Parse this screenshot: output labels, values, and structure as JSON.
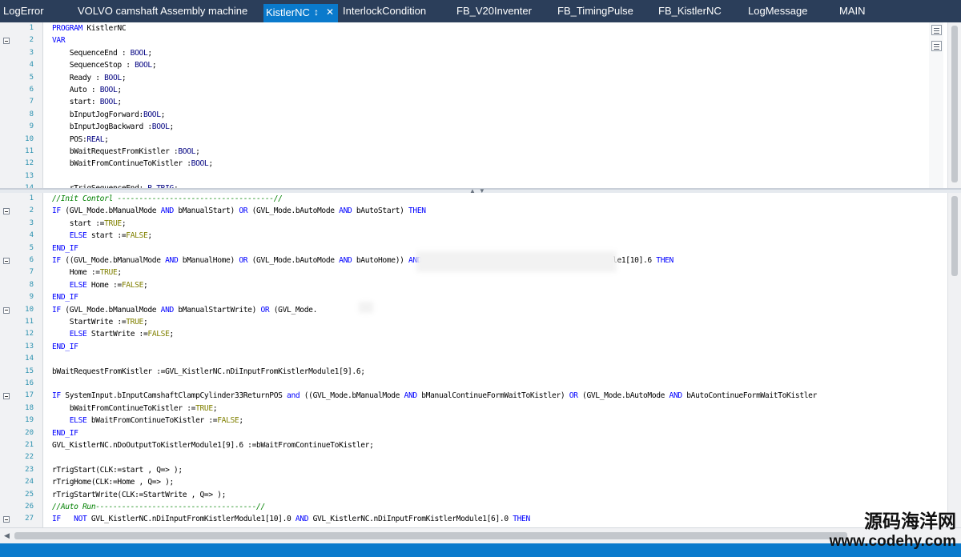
{
  "tabs": [
    {
      "label": "LogError"
    },
    {
      "label": "VOLVO camshaft Assembly machine"
    },
    {
      "label": "KistlerNC",
      "active": true
    },
    {
      "label": "InterlockCondition"
    },
    {
      "label": "FB_V20Inventer"
    },
    {
      "label": "FB_TimingPulse"
    },
    {
      "label": "FB_KistlerNC"
    },
    {
      "label": "LogMessage"
    },
    {
      "label": "MAIN"
    }
  ],
  "active_tab_pin_icon": "pin-icon",
  "active_tab_close_icon": "close-icon",
  "declaration_lines": [
    {
      "n": "1",
      "fold": false
    },
    {
      "n": "2",
      "fold": true
    },
    {
      "n": "3",
      "fold": false
    },
    {
      "n": "4",
      "fold": false
    },
    {
      "n": "5",
      "fold": false
    },
    {
      "n": "6",
      "fold": false
    },
    {
      "n": "7",
      "fold": false
    },
    {
      "n": "8",
      "fold": false
    },
    {
      "n": "9",
      "fold": false
    },
    {
      "n": "10",
      "fold": false
    },
    {
      "n": "11",
      "fold": false
    },
    {
      "n": "12",
      "fold": false
    },
    {
      "n": "13",
      "fold": false
    },
    {
      "n": "14",
      "fold": false
    }
  ],
  "declaration_code": [
    "PROGRAM KistlerNC",
    "VAR",
    "    SequenceEnd : BOOL;",
    "    SequenceStop : BOOL;",
    "    Ready : BOOL;",
    "    Auto : BOOL;",
    "    start: BOOL;",
    "    bInputJogForward:BOOL;",
    "    bInputJogBackward :BOOL;",
    "    POS:REAL;",
    "    bWaitRequestFromKistler :BOOL;",
    "    bWaitFromContinueToKistler :BOOL;",
    "",
    "    rTrigSequenceEnd: R_TRIG;"
  ],
  "implementation_lines": [
    {
      "n": "1",
      "fold": false
    },
    {
      "n": "2",
      "fold": true
    },
    {
      "n": "3",
      "fold": false
    },
    {
      "n": "4",
      "fold": false
    },
    {
      "n": "5",
      "fold": false
    },
    {
      "n": "6",
      "fold": true
    },
    {
      "n": "7",
      "fold": false
    },
    {
      "n": "8",
      "fold": false
    },
    {
      "n": "9",
      "fold": false
    },
    {
      "n": "10",
      "fold": true
    },
    {
      "n": "11",
      "fold": false
    },
    {
      "n": "12",
      "fold": false
    },
    {
      "n": "13",
      "fold": false
    },
    {
      "n": "14",
      "fold": false
    },
    {
      "n": "15",
      "fold": false
    },
    {
      "n": "16",
      "fold": false
    },
    {
      "n": "17",
      "fold": true
    },
    {
      "n": "18",
      "fold": false
    },
    {
      "n": "19",
      "fold": false
    },
    {
      "n": "20",
      "fold": false
    },
    {
      "n": "21",
      "fold": false
    },
    {
      "n": "22",
      "fold": false
    },
    {
      "n": "23",
      "fold": false
    },
    {
      "n": "24",
      "fold": false
    },
    {
      "n": "25",
      "fold": false
    },
    {
      "n": "26",
      "fold": false
    },
    {
      "n": "27",
      "fold": true
    }
  ],
  "implementation_code": [
    "//Init Contorl ------------------------------------//",
    "IF (GVL_Mode.bManualMode AND bManualStart) OR (GVL_Mode.bAutoMode AND bAutoStart) THEN",
    "    start :=TRUE;",
    "    ELSE start :=FALSE;",
    "END_IF",
    "IF ((GVL_Mode.bManualMode AND bManualHome) OR (GVL_Mode.bAutoMode AND bAutoHome)) AND NOT G                      tFromKistlerModule1[10].6 THEN",
    "    Home :=TRUE;",
    "    ELSE Home :=FALSE;",
    "END_IF",
    "IF (GVL_Mode.bManualMode AND bManualStartWrite) OR (GVL_Mode.",
    "    StartWrite :=TRUE;",
    "    ELSE StartWrite :=FALSE;",
    "END_IF",
    "",
    "bWaitRequestFromKistler :=GVL_KistlerNC.nDiInputFromKistlerModule1[9].6;",
    "",
    "IF SystemInput.bInputCamshaftClampCylinder33ReturnPOS and ((GVL_Mode.bManualMode AND bManualContinueFormWaitToKistler) OR (GVL_Mode.bAutoMode AND bAutoContinueFormWaitToKistler",
    "    bWaitFromContinueToKistler :=TRUE;",
    "    ELSE bWaitFromContinueToKistler :=FALSE;",
    "END_IF",
    "GVL_KistlerNC.nDoOutputToKistlerModule1[9].6 :=bWaitFromContinueToKistler;",
    "",
    "rTrigStart(CLK:=start , Q=> );",
    "rTrigHome(CLK:=Home , Q=> );",
    "rTrigStartWrite(CLK:=StartWrite , Q=> );",
    "//Auto Run-------------------------------------//",
    "IF   NOT GVL_KistlerNC.nDiInputFromKistlerModule1[10].0 AND GVL_KistlerNC.nDiInputFromKistlerModule1[6].0 THEN"
  ],
  "watermark": {
    "cn": "源码海洋网",
    "url": "www.codehy.com"
  },
  "colors": {
    "tab_bar": "#2b3e5a",
    "active_tab": "#0a7acc",
    "keyword": "#0000ff",
    "type": "#000080",
    "literal": "#808000",
    "comment": "#008000",
    "line_number": "#2b91af",
    "status_bar": "#0a7acc"
  }
}
